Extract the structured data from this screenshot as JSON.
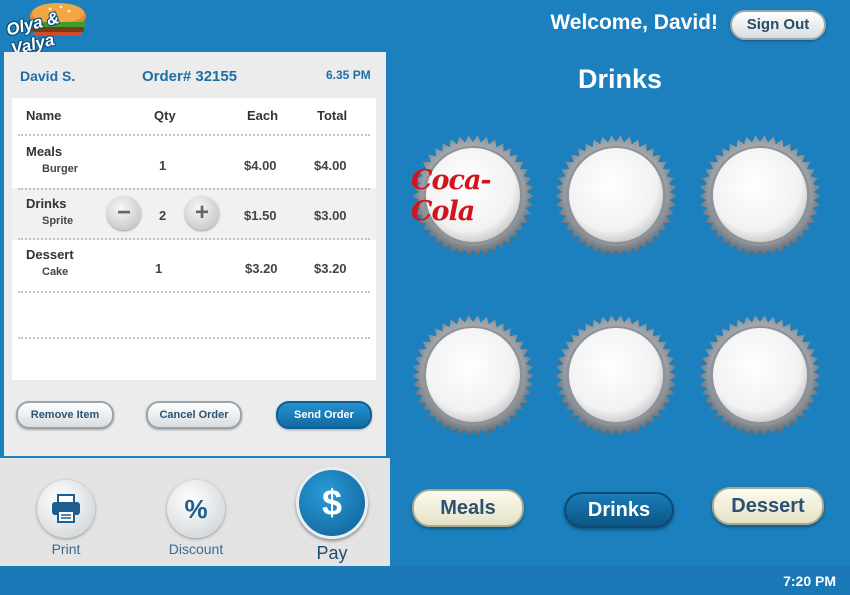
{
  "header": {
    "logo_text": "Olya & Valya",
    "welcome": "Welcome, David!",
    "sign_out": "Sign Out"
  },
  "order": {
    "customer": "David S.",
    "order_number": "Order# 32155",
    "time": "6.35 PM",
    "columns": [
      "Name",
      "Qty",
      "Each",
      "Total"
    ],
    "rows": [
      {
        "category": "Meals",
        "item": "Burger",
        "qty": "1",
        "each": "$4.00",
        "total": "$4.00"
      },
      {
        "category": "Drinks",
        "item": "Sprite",
        "qty": "2",
        "each": "$1.50",
        "total": "$3.00"
      },
      {
        "category": "Dessert",
        "item": "Cake",
        "qty": "1",
        "each": "$3.20",
        "total": "$3.20"
      }
    ],
    "actions": {
      "remove": "Remove Item",
      "cancel": "Cancel Order",
      "send": "Send Order"
    }
  },
  "toolbar": {
    "print": "Print",
    "discount": "Discount",
    "pay": "Pay",
    "discount_symbol": "%",
    "pay_symbol": "$"
  },
  "drinks_panel": {
    "title": "Drinks",
    "caps": [
      {
        "brand": "Coca-Cola"
      },
      {
        "brand": ""
      },
      {
        "brand": ""
      },
      {
        "brand": ""
      },
      {
        "brand": ""
      },
      {
        "brand": ""
      }
    ],
    "categories": [
      {
        "label": "Meals",
        "active": false
      },
      {
        "label": "Drinks",
        "active": true
      },
      {
        "label": "Dessert",
        "active": false
      }
    ]
  },
  "footer": {
    "clock": "7:20 PM"
  },
  "colors": {
    "background": "#1b80bd",
    "accent": "#136aa2",
    "brand_red": "#d2141e"
  }
}
